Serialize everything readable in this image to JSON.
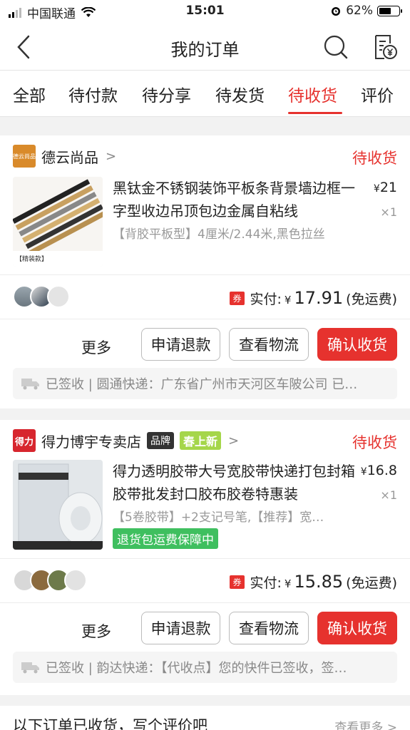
{
  "status_bar": {
    "carrier": "中国联通",
    "time": "15:01",
    "battery": "62%",
    "battery_level": 0.62
  },
  "nav": {
    "title": "我的订单",
    "back_icon": "chevron-left-icon",
    "search_icon": "search-icon",
    "bill_icon": "bill-icon"
  },
  "tabs": [
    {
      "label": "全部",
      "active": false
    },
    {
      "label": "待付款",
      "active": false
    },
    {
      "label": "待分享",
      "active": false
    },
    {
      "label": "待发货",
      "active": false
    },
    {
      "label": "待收货",
      "active": true
    },
    {
      "label": "评价",
      "active": false
    }
  ],
  "orders": [
    {
      "store": "德云尚品",
      "store_logo_text": "德云尚品",
      "status": "待收货",
      "title": "黑钛金不锈钢装饰平板条背景墙边框一字型收边吊顶包边金属自粘线",
      "price": "21",
      "qty": "×1",
      "spec": "【背胶平板型】4厘米/2.44米,黑色拉丝",
      "coupon": "券",
      "paid_label": "实付:",
      "paid_amount": "17.91",
      "shipping": "(免运费)",
      "btn_more": "更多",
      "btn_refund": "申请退款",
      "btn_logistics": "查看物流",
      "btn_confirm": "确认收货",
      "logistics_text": "已签收 | 圆通快递：广东省广州市天河区车陂公司 已…"
    },
    {
      "store": "得力博宇专卖店",
      "store_logo_text": "得力",
      "badge_brand": "品牌",
      "badge_spring": "春上新",
      "status": "待收货",
      "title": "得力透明胶带大号宽胶带快递打包封箱胶带批发封口胶布胶卷特惠装",
      "price": "16.8",
      "qty": "×1",
      "spec": "【5卷胶带】+2支记号笔,【推荐】宽…",
      "return_tag": "退货包运费保障中",
      "coupon": "券",
      "paid_label": "实付:",
      "paid_amount": "15.85",
      "shipping": "(免运费)",
      "btn_more": "更多",
      "btn_refund": "申请退款",
      "btn_logistics": "查看物流",
      "btn_confirm": "确认收货",
      "logistics_text": "已签收 | 韵达快递：【代收点】您的快件已签收，签…"
    }
  ],
  "bottom": {
    "title": "以下订单已收货，写个评价吧",
    "more": "查看更多 >"
  },
  "colors": {
    "accent": "#e6322e",
    "green": "#3fbf5f",
    "spring_badge": "#a5d64a"
  }
}
